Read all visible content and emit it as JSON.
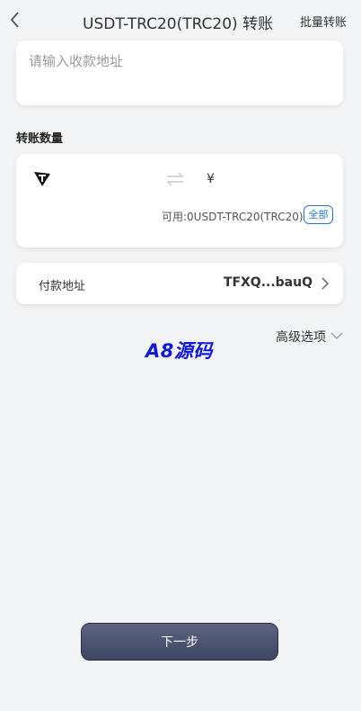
{
  "header": {
    "title": "USDT-TRC20(TRC20) 转账",
    "batch_link": "批量转账"
  },
  "recipient": {
    "placeholder": "请输入收款地址"
  },
  "amount": {
    "section_label": "转账数量",
    "currency_symbol": "¥",
    "available": "可用:0USDT-TRC20(TRC20)",
    "all_label": "全部"
  },
  "payment": {
    "label": "付款地址",
    "address": "TFXQ...bauQ"
  },
  "advanced": {
    "label": "高级选项"
  },
  "watermark": "A8源码",
  "footer": {
    "next_label": "下一步"
  },
  "icons": {
    "back": "back-icon",
    "token": "tron-token-icon",
    "swap": "swap-arrows-icon",
    "forward": "chevron-right-icon",
    "expand": "chevron-down-icon"
  },
  "colors": {
    "accent": "#1f7ad6",
    "button": "#4a5070",
    "watermark": "#1118dd"
  }
}
